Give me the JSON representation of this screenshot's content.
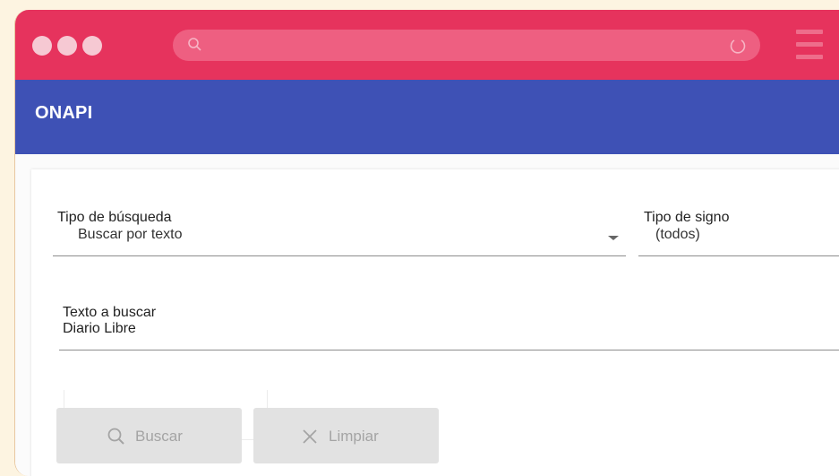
{
  "browser": {
    "window_controls": [
      "close-dot",
      "minimize-dot",
      "maximize-dot"
    ],
    "address_bar": {
      "value": "",
      "search_icon": "search-icon",
      "reload_icon": "reload-icon"
    },
    "menu_icon": "hamburger-menu-icon",
    "colors": {
      "chrome": "#e6335d",
      "address_bar": "#ee5f81"
    }
  },
  "header": {
    "title": "ONAPI",
    "color": "#3e51b5"
  },
  "form": {
    "tipo_busqueda": {
      "label": "Tipo de búsqueda",
      "value": "Buscar por texto"
    },
    "tipo_signo": {
      "label": "Tipo de signo",
      "value": "(todos)"
    },
    "texto_buscar": {
      "label": "Texto a buscar",
      "value": "Diario Libre"
    },
    "buttons": {
      "search": {
        "label": "Buscar",
        "icon": "search-icon"
      },
      "clear": {
        "label": "Limpiar",
        "icon": "close-icon"
      }
    }
  }
}
